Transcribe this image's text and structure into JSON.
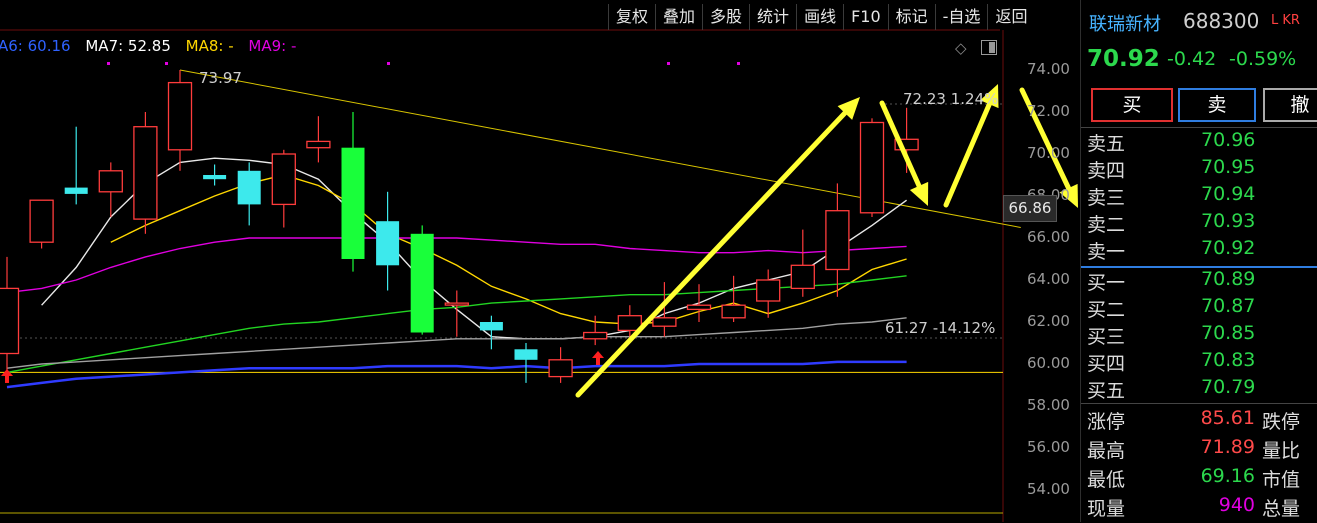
{
  "toolbar": {
    "items": [
      "复权",
      "叠加",
      "多股",
      "统计",
      "画线",
      "F10",
      "标记",
      "-自选",
      "返回"
    ]
  },
  "ma_legend": [
    {
      "text": "A6: 60.16",
      "color": "#2f62ff"
    },
    {
      "text": "MA7: 52.85",
      "color": "#ffffff"
    },
    {
      "text": "MA8: -",
      "color": "#ffd700"
    },
    {
      "text": "MA9: -",
      "color": "#e000e0"
    }
  ],
  "chart_icons": [
    "diamond-icon",
    "layout-toggle-icon"
  ],
  "price_axis": {
    "ticks": [
      "74.00",
      "72.00",
      "70.00",
      "68.00",
      "66.00",
      "64.00",
      "62.00",
      "60.00",
      "58.00",
      "56.00",
      "54.00"
    ]
  },
  "current_price_tag": "66.86",
  "annotations": {
    "high_label": "73.97",
    "right_high": "72.23  1.24%",
    "right_low": "61.27  -14.12%"
  },
  "chart_data": {
    "type": "candlestick",
    "ylim": [
      53,
      75
    ],
    "candles": [
      {
        "o": 60.5,
        "h": 65.1,
        "l": 59.2,
        "c": 63.6
      },
      {
        "o": 65.8,
        "h": 67.8,
        "l": 65.5,
        "c": 67.8
      },
      {
        "o": 68.4,
        "h": 71.3,
        "l": 67.6,
        "c": 68.1
      },
      {
        "o": 68.2,
        "h": 69.6,
        "l": 67.0,
        "c": 69.2
      },
      {
        "o": 66.9,
        "h": 72.0,
        "l": 66.2,
        "c": 71.3
      },
      {
        "o": 70.2,
        "h": 74.0,
        "l": 69.2,
        "c": 73.4
      },
      {
        "o": 69.0,
        "h": 69.5,
        "l": 68.5,
        "c": 68.8
      },
      {
        "o": 69.2,
        "h": 69.6,
        "l": 66.6,
        "c": 67.6
      },
      {
        "o": 67.6,
        "h": 70.2,
        "l": 66.5,
        "c": 70.0
      },
      {
        "o": 70.3,
        "h": 71.8,
        "l": 69.6,
        "c": 70.6
      },
      {
        "o": 70.3,
        "h": 72.0,
        "l": 64.4,
        "c": 65.0
      },
      {
        "o": 66.8,
        "h": 68.2,
        "l": 63.5,
        "c": 64.7
      },
      {
        "o": 66.2,
        "h": 66.6,
        "l": 61.4,
        "c": 61.5
      },
      {
        "o": 62.9,
        "h": 63.5,
        "l": 61.3,
        "c": 62.9
      },
      {
        "o": 62.0,
        "h": 62.3,
        "l": 60.7,
        "c": 61.6
      },
      {
        "o": 60.7,
        "h": 61.0,
        "l": 59.1,
        "c": 60.2
      },
      {
        "o": 59.4,
        "h": 60.8,
        "l": 59.1,
        "c": 60.2
      },
      {
        "o": 61.2,
        "h": 62.3,
        "l": 60.9,
        "c": 61.5
      },
      {
        "o": 61.6,
        "h": 62.8,
        "l": 61.3,
        "c": 62.3
      },
      {
        "o": 61.8,
        "h": 63.9,
        "l": 61.3,
        "c": 62.2
      },
      {
        "o": 62.6,
        "h": 63.8,
        "l": 62.0,
        "c": 62.8
      },
      {
        "o": 62.2,
        "h": 64.2,
        "l": 62.0,
        "c": 62.8
      },
      {
        "o": 63.0,
        "h": 64.5,
        "l": 62.2,
        "c": 64.0
      },
      {
        "o": 63.6,
        "h": 66.4,
        "l": 63.2,
        "c": 64.7
      },
      {
        "o": 64.5,
        "h": 68.6,
        "l": 63.2,
        "c": 67.3
      },
      {
        "o": 67.2,
        "h": 71.7,
        "l": 67.0,
        "c": 71.5
      },
      {
        "o": 70.2,
        "h": 72.2,
        "l": 69.1,
        "c": 70.7
      }
    ],
    "series": [
      {
        "name": "MA7",
        "color": "#e8e8e8",
        "values": [
          null,
          62.8,
          64.6,
          67.0,
          68.6,
          69.6,
          69.8,
          69.7,
          69.5,
          68.8,
          67.2,
          65.8,
          64.0,
          62.6,
          61.3,
          61.2,
          61.2,
          61.3,
          61.6,
          62.4,
          62.9,
          63.6,
          64.0,
          64.4,
          65.5,
          66.6,
          67.8
        ]
      },
      {
        "name": "MA8",
        "color": "#ffd700",
        "values": [
          null,
          null,
          null,
          65.8,
          66.6,
          67.3,
          68.0,
          68.6,
          69.0,
          68.5,
          67.6,
          66.2,
          65.5,
          64.7,
          63.7,
          63.1,
          62.4,
          62.0,
          61.9,
          62.0,
          62.5,
          62.9,
          62.4,
          62.9,
          63.5,
          64.5,
          65.0
        ]
      },
      {
        "name": "MA9",
        "color": "#e000e0",
        "values": [
          63.4,
          63.6,
          64.0,
          64.6,
          65.1,
          65.5,
          65.8,
          66.0,
          66.0,
          66.0,
          66.0,
          66.0,
          66.0,
          66.0,
          65.9,
          65.8,
          65.7,
          65.7,
          65.5,
          65.4,
          65.3,
          65.3,
          65.4,
          65.3,
          65.4,
          65.5,
          65.6
        ]
      },
      {
        "name": "MA-green",
        "color": "#22d422",
        "values": [
          59.6,
          59.9,
          60.2,
          60.5,
          60.8,
          61.1,
          61.4,
          61.7,
          61.9,
          62.0,
          62.2,
          62.4,
          62.6,
          62.7,
          62.9,
          63.0,
          63.1,
          63.2,
          63.3,
          63.3,
          63.4,
          63.5,
          63.6,
          63.7,
          63.8,
          64.0,
          64.2
        ]
      },
      {
        "name": "A6",
        "color": "#2f3bff",
        "values": [
          58.9,
          59.1,
          59.3,
          59.4,
          59.5,
          59.6,
          59.7,
          59.8,
          59.8,
          59.8,
          59.8,
          59.9,
          59.9,
          59.9,
          59.8,
          59.9,
          59.8,
          59.9,
          59.9,
          59.9,
          60.0,
          60.0,
          60.0,
          60.0,
          60.1,
          60.1,
          60.1
        ]
      },
      {
        "name": "grey",
        "color": "#a0a0a0",
        "values": [
          59.8,
          60.0,
          60.1,
          60.2,
          60.3,
          60.4,
          60.5,
          60.6,
          60.7,
          60.8,
          60.9,
          61.0,
          61.1,
          61.2,
          61.2,
          61.2,
          61.2,
          61.3,
          61.3,
          61.3,
          61.4,
          61.5,
          61.6,
          61.7,
          61.9,
          62.0,
          62.2
        ]
      }
    ],
    "trendline": {
      "from": [
        5,
        74.0
      ],
      "to": [
        29.3,
        66.5
      ],
      "color": "#d8c400"
    },
    "support_line": {
      "value": 59.6,
      "color": "#ffd700"
    }
  },
  "stock": {
    "name": "联瑞新材",
    "code": "688300",
    "flag": "L KR"
  },
  "quote": {
    "price": "70.92",
    "change": "-0.42",
    "pct": "-0.59%"
  },
  "trade_buttons": {
    "buy": "买",
    "sell": "卖",
    "cancel": "撤"
  },
  "order_book": {
    "asks": [
      {
        "label": "卖五",
        "price": "70.96"
      },
      {
        "label": "卖四",
        "price": "70.95"
      },
      {
        "label": "卖三",
        "price": "70.94"
      },
      {
        "label": "卖二",
        "price": "70.93"
      },
      {
        "label": "卖一",
        "price": "70.92"
      }
    ],
    "bids": [
      {
        "label": "买一",
        "price": "70.89"
      },
      {
        "label": "买二",
        "price": "70.87"
      },
      {
        "label": "买三",
        "price": "70.85"
      },
      {
        "label": "买四",
        "price": "70.83"
      },
      {
        "label": "买五",
        "price": "70.79"
      }
    ]
  },
  "stats": [
    {
      "label": "涨停",
      "value": "85.61",
      "value_color": "#ff4a4a",
      "label2": "跌停"
    },
    {
      "label": "最高",
      "value": "71.89",
      "value_color": "#ff4a4a",
      "label2": "量比"
    },
    {
      "label": "最低",
      "value": "69.16",
      "value_color": "#2cd84d",
      "label2": "市值"
    },
    {
      "label": "现量",
      "value": "940",
      "value_color": "#e000e0",
      "label2": "总量"
    }
  ]
}
